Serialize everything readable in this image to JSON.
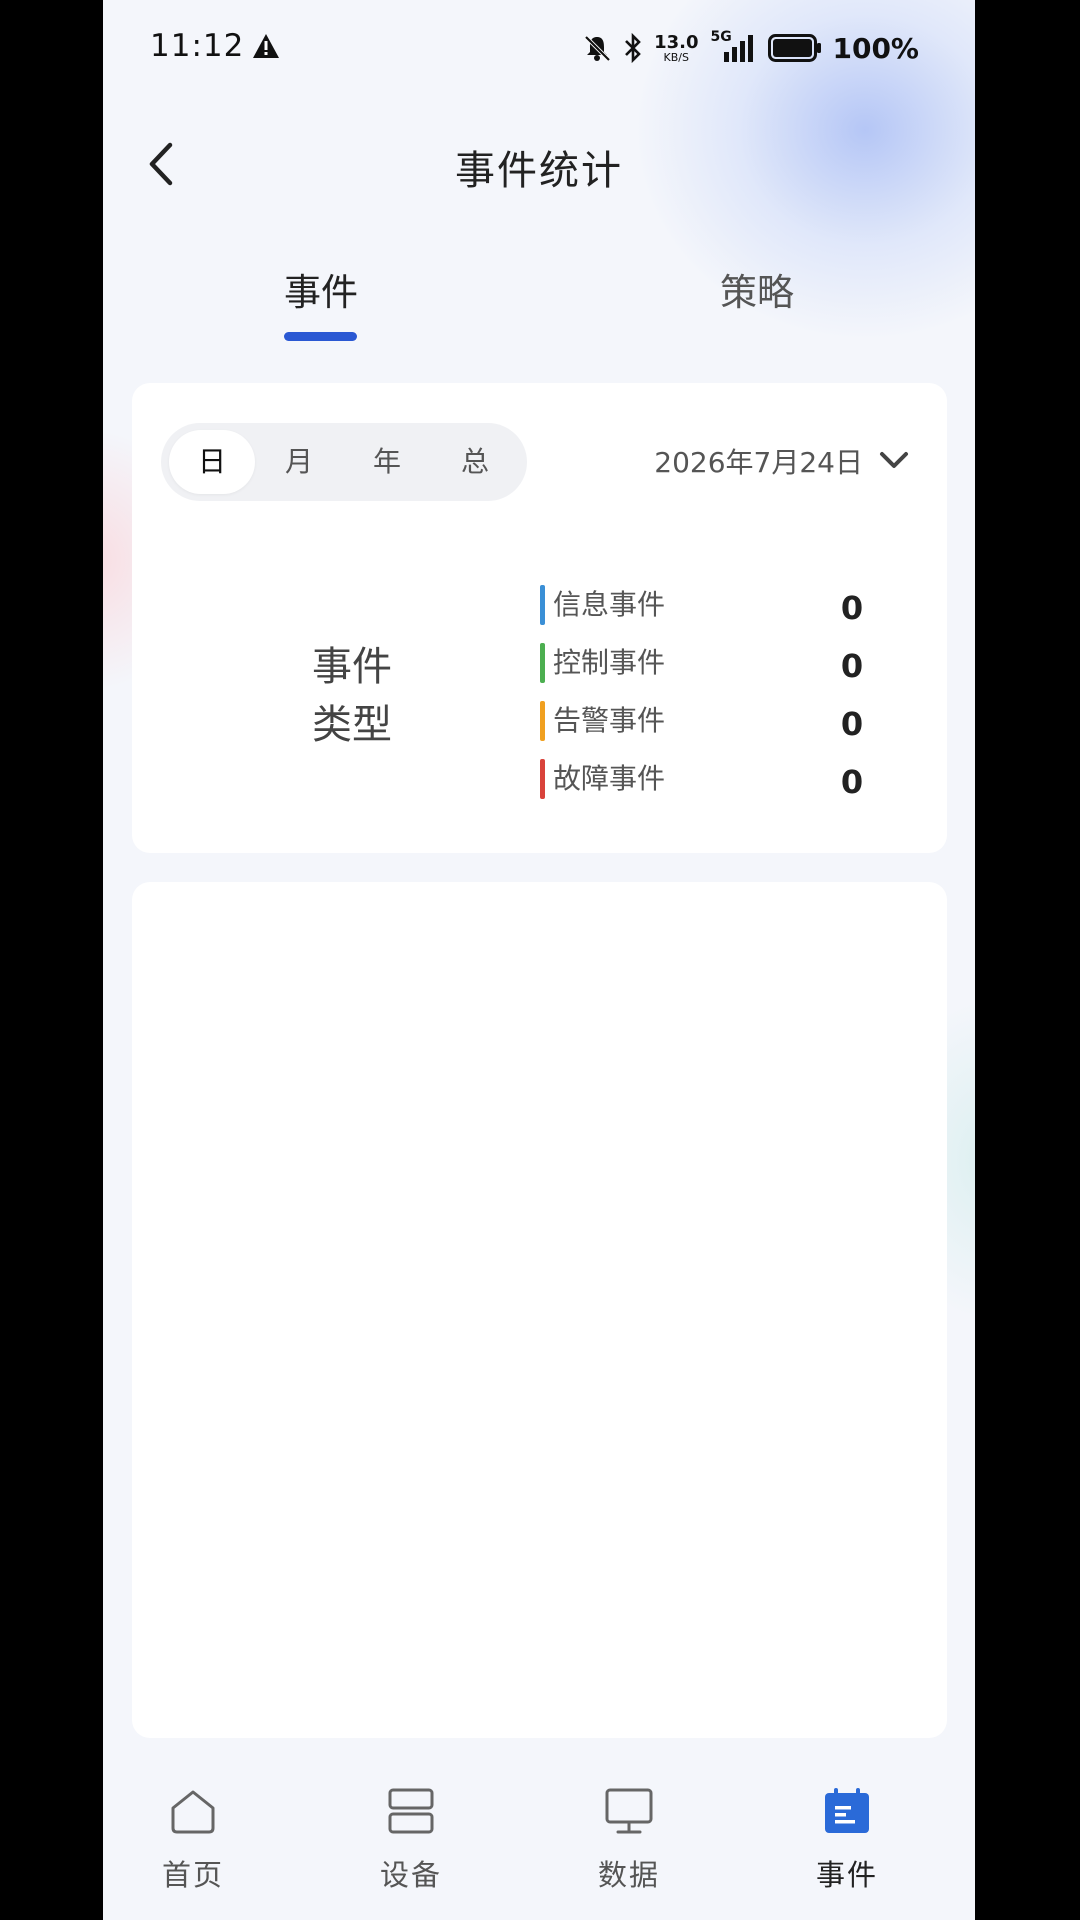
{
  "status_bar": {
    "time": "11:12",
    "net_speed_value": "13.0",
    "net_speed_unit": "KB/S",
    "signal_label": "5G",
    "battery": "100%"
  },
  "header": {
    "title": "事件统计"
  },
  "tabs": [
    {
      "label": "事件",
      "active": true
    },
    {
      "label": "策略",
      "active": false
    }
  ],
  "filter": {
    "periods": [
      "日",
      "月",
      "年",
      "总"
    ],
    "selected_period": "日",
    "date": "2026年7月24日"
  },
  "event_types": {
    "label_line1": "事件",
    "label_line2": "类型",
    "items": [
      {
        "name": "信息事件",
        "count": "0",
        "color": "#3a8fd6"
      },
      {
        "name": "控制事件",
        "count": "0",
        "color": "#4caf50"
      },
      {
        "name": "告警事件",
        "count": "0",
        "color": "#f0a020"
      },
      {
        "name": "故障事件",
        "count": "0",
        "color": "#d9433b"
      }
    ]
  },
  "bottom_nav": [
    {
      "label": "首页",
      "icon": "home-icon",
      "active": false
    },
    {
      "label": "设备",
      "icon": "device-icon",
      "active": false
    },
    {
      "label": "数据",
      "icon": "monitor-icon",
      "active": false
    },
    {
      "label": "事件",
      "icon": "calendar-icon",
      "active": true
    }
  ],
  "colors": {
    "accent": "#2a58d3",
    "background": "#f4f6fb"
  }
}
